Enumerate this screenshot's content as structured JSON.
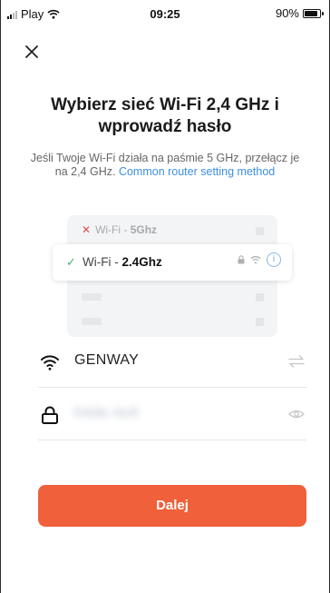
{
  "status_bar": {
    "carrier": "Play",
    "time": "09:25",
    "battery_percent": "90%",
    "battery_level": 0.9
  },
  "page": {
    "title": "Wybierz sieć Wi-Fi 2,4 GHz i wprowadź hasło",
    "subtitle_text": "Jeśli Twoje Wi-Fi działa na paśmie 5 GHz, przełącz je na 2,4 GHz. ",
    "subtitle_link": "Common router setting method"
  },
  "illustration": {
    "wrong_prefix": "Wi-Fi - ",
    "wrong_band": "5Ghz",
    "right_prefix": "Wi-Fi - ",
    "right_band": "2.4Ghz"
  },
  "form": {
    "ssid_value": "GENWAY",
    "password_value": "h4de-4u5"
  },
  "actions": {
    "next_label": "Dalej"
  },
  "colors": {
    "accent": "#f0603a",
    "link": "#3d8fe0",
    "success": "#4caf77",
    "error": "#e34b4b"
  },
  "icons": [
    "signal-icon",
    "wifi-icon",
    "battery-icon",
    "close-icon",
    "lock-icon",
    "info-icon",
    "swap-icon",
    "eye-icon"
  ]
}
